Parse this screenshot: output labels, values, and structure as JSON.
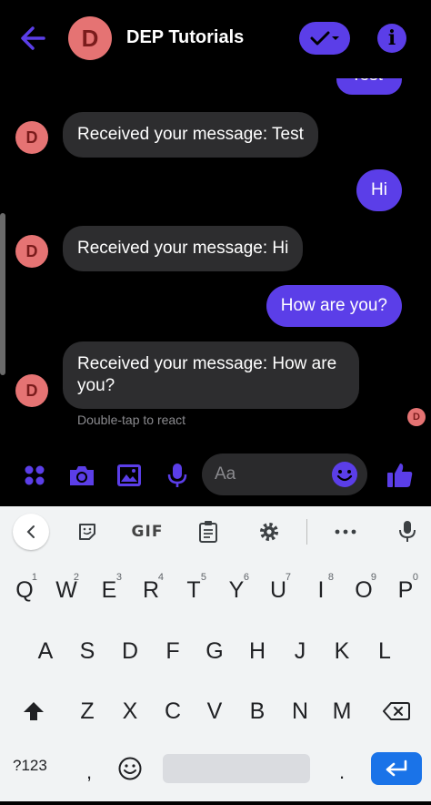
{
  "header": {
    "avatar_letter": "D",
    "title": "DEP Tutorials"
  },
  "messages": [
    {
      "type": "out",
      "text": "Test"
    },
    {
      "type": "in",
      "text": "Received your message: Test",
      "avatar": "D"
    },
    {
      "type": "out",
      "text": "Hi"
    },
    {
      "type": "in",
      "text": "Received your message: Hi",
      "avatar": "D"
    },
    {
      "type": "out",
      "text": "How are you?"
    },
    {
      "type": "in",
      "text": "Received your message: How are you?",
      "avatar": "D"
    }
  ],
  "react_hint": "Double-tap to react",
  "seen_avatar": "D",
  "composer": {
    "placeholder": "Aa"
  },
  "keyboard": {
    "gif_label": "GIF",
    "row1": [
      {
        "k": "Q",
        "n": "1"
      },
      {
        "k": "W",
        "n": "2"
      },
      {
        "k": "E",
        "n": "3"
      },
      {
        "k": "R",
        "n": "4"
      },
      {
        "k": "T",
        "n": "5"
      },
      {
        "k": "Y",
        "n": "6"
      },
      {
        "k": "U",
        "n": "7"
      },
      {
        "k": "I",
        "n": "8"
      },
      {
        "k": "O",
        "n": "9"
      },
      {
        "k": "P",
        "n": "0"
      }
    ],
    "row2": [
      "A",
      "S",
      "D",
      "F",
      "G",
      "H",
      "J",
      "K",
      "L"
    ],
    "row3": [
      "Z",
      "X",
      "C",
      "V",
      "B",
      "N",
      "M"
    ],
    "symbols_label": "?123",
    "comma": ",",
    "period": "."
  },
  "colors": {
    "accent": "#5b3ee8",
    "incoming_bubble": "#2d2d2f",
    "avatar": "#e57373",
    "enter_key": "#1a73e8"
  }
}
